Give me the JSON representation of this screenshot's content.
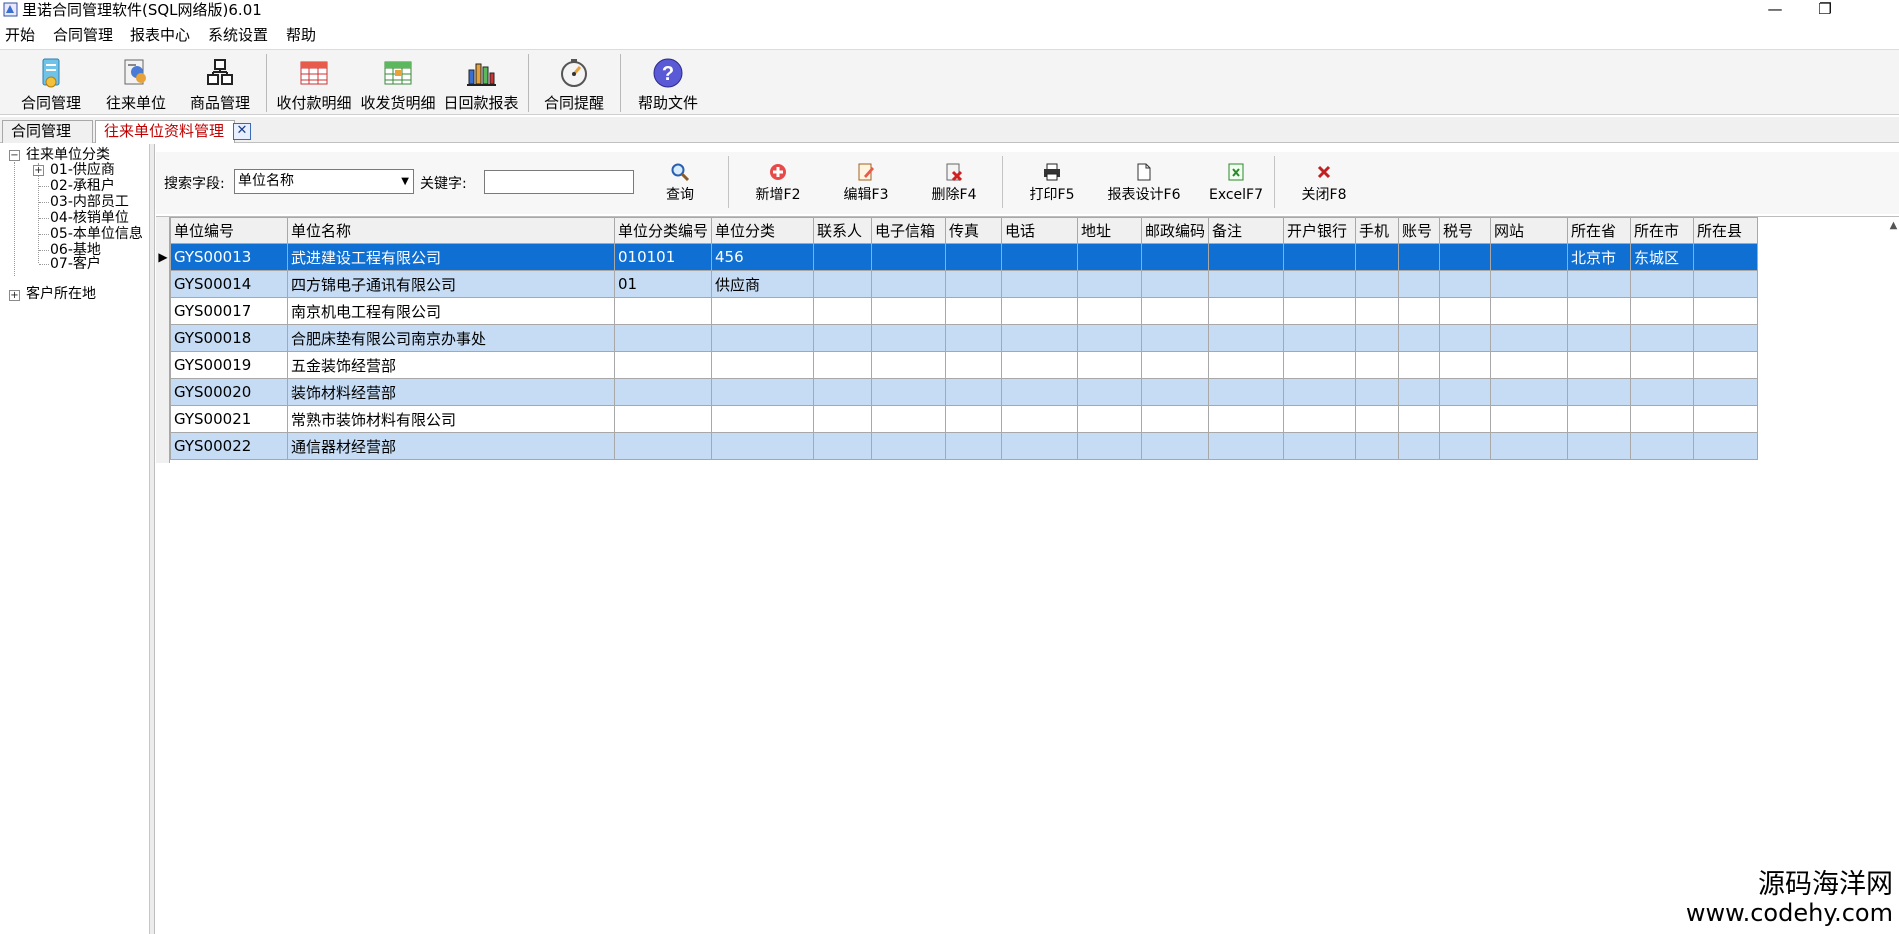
{
  "window": {
    "title": "里诺合同管理软件(SQL网络版)6.01",
    "minimize": "—",
    "restore": "❐"
  },
  "menu": [
    "开始",
    "合同管理",
    "报表中心",
    "系统设置",
    "帮助"
  ],
  "toolbar": {
    "buttons": [
      {
        "label": "合同管理",
        "icon": "contract-icon"
      },
      {
        "label": "往来单位",
        "icon": "contacts-icon"
      },
      {
        "label": "商品管理",
        "icon": "products-icon"
      },
      {
        "label": "收付款明细",
        "icon": "payment-detail-icon"
      },
      {
        "label": "收发货明细",
        "icon": "shipment-detail-icon"
      },
      {
        "label": "日回款报表",
        "icon": "daily-report-icon"
      },
      {
        "label": "合同提醒",
        "icon": "reminder-icon"
      },
      {
        "label": "帮助文件",
        "icon": "help-icon"
      }
    ]
  },
  "tabs": [
    {
      "label": "合同管理",
      "active": false
    },
    {
      "label": "往来单位资料管理",
      "active": true,
      "close": "✕"
    }
  ],
  "tree": {
    "root": "往来单位分类",
    "children": [
      "01-供应商",
      "02-承租户",
      "03-内部员工",
      "04-核销单位",
      "05-本单位信息",
      "06-基地",
      "07-客户"
    ],
    "second_root": "客户所在地",
    "toggle_expanded": "−",
    "toggle_collapsed": "+"
  },
  "search": {
    "field_label": "搜索字段:",
    "field_value": "单位名称",
    "keyword_label": "关键字:",
    "keyword_value": "",
    "actions": [
      {
        "label": "查询",
        "icon": "search-icon"
      },
      {
        "label": "新增F2",
        "icon": "add-icon"
      },
      {
        "label": "编辑F3",
        "icon": "edit-icon"
      },
      {
        "label": "删除F4",
        "icon": "delete-icon"
      },
      {
        "label": "打印F5",
        "icon": "print-icon"
      },
      {
        "label": "报表设计F6",
        "icon": "report-design-icon"
      },
      {
        "label": "ExcelF7",
        "icon": "excel-icon"
      },
      {
        "label": "关闭F8",
        "icon": "close-icon"
      }
    ]
  },
  "grid": {
    "columns": [
      "单位编号",
      "单位名称",
      "单位分类编号",
      "单位分类",
      "联系人",
      "电子信箱",
      "传真",
      "电话",
      "地址",
      "邮政编码",
      "备注",
      "开户银行",
      "手机",
      "账号",
      "税号",
      "网站",
      "所在省",
      "所在市",
      "所在县"
    ],
    "selected_indicator": "▶",
    "rows": [
      [
        "GYS00013",
        "武进建设工程有限公司",
        "010101",
        "456",
        "",
        "",
        "",
        "",
        "",
        "",
        "",
        "",
        "",
        "",
        "",
        "",
        "北京市",
        "东城区",
        ""
      ],
      [
        "GYS00014",
        "四方锦电子通讯有限公司",
        "01",
        "供应商",
        "",
        "",
        "",
        "",
        "",
        "",
        "",
        "",
        "",
        "",
        "",
        "",
        "",
        "",
        ""
      ],
      [
        "GYS00017",
        "南京机电工程有限公司",
        "",
        "",
        "",
        "",
        "",
        "",
        "",
        "",
        "",
        "",
        "",
        "",
        "",
        "",
        "",
        "",
        ""
      ],
      [
        "GYS00018",
        "合肥床垫有限公司南京办事处",
        "",
        "",
        "",
        "",
        "",
        "",
        "",
        "",
        "",
        "",
        "",
        "",
        "",
        "",
        "",
        "",
        ""
      ],
      [
        "GYS00019",
        "五金装饰经营部",
        "",
        "",
        "",
        "",
        "",
        "",
        "",
        "",
        "",
        "",
        "",
        "",
        "",
        "",
        "",
        "",
        ""
      ],
      [
        "GYS00020",
        "装饰材料经营部",
        "",
        "",
        "",
        "",
        "",
        "",
        "",
        "",
        "",
        "",
        "",
        "",
        "",
        "",
        "",
        "",
        ""
      ],
      [
        "GYS00021",
        "常熟市装饰材料有限公司",
        "",
        "",
        "",
        "",
        "",
        "",
        "",
        "",
        "",
        "",
        "",
        "",
        "",
        "",
        "",
        "",
        ""
      ],
      [
        "GYS00022",
        "通信器材经营部",
        "",
        "",
        "",
        "",
        "",
        "",
        "",
        "",
        "",
        "",
        "",
        "",
        "",
        "",
        "",
        "",
        ""
      ]
    ]
  },
  "watermark": {
    "name": "源码海洋网",
    "url": "www.codehy.com"
  },
  "colors": {
    "selected_row": "#0f6fd2",
    "alt_row": "#c5dcf4",
    "active_tab_text": "#c00000"
  }
}
